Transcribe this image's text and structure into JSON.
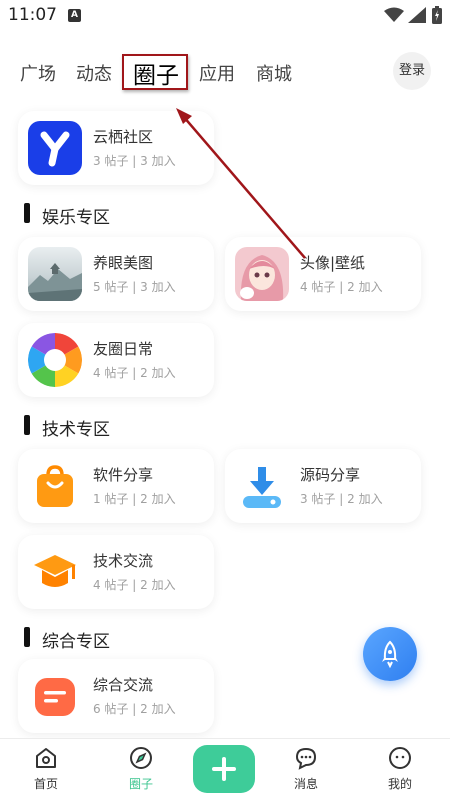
{
  "status_bar": {
    "time": "11:07",
    "notification_letter": "A"
  },
  "tabs": [
    {
      "label": "广场"
    },
    {
      "label": "动态"
    },
    {
      "label": "圈子"
    },
    {
      "label": "应用"
    },
    {
      "label": "商城"
    }
  ],
  "login_label": "登录",
  "featured": {
    "name": "云栖社区",
    "meta": "3 帖子 | 3 加入"
  },
  "sections": [
    {
      "title": "娱乐专区",
      "items": [
        {
          "name": "养眼美图",
          "meta": "5 帖子 | 3 加入"
        },
        {
          "name": "头像|壁纸",
          "meta": "4 帖子 | 2 加入"
        },
        {
          "name": "友圈日常",
          "meta": "4 帖子 | 2 加入"
        }
      ]
    },
    {
      "title": "技术专区",
      "items": [
        {
          "name": "软件分享",
          "meta": "1 帖子 | 2 加入"
        },
        {
          "name": "源码分享",
          "meta": "3 帖子 | 2 加入"
        },
        {
          "name": "技术交流",
          "meta": "4 帖子 | 2 加入"
        }
      ]
    },
    {
      "title": "综合专区",
      "items": [
        {
          "name": "综合交流",
          "meta": "6 帖子 | 2 加入"
        }
      ]
    }
  ],
  "bottom_nav": [
    {
      "label": "首页",
      "icon": "home-icon"
    },
    {
      "label": "圈子",
      "icon": "compass-icon"
    },
    {
      "label": "",
      "icon": "plus-icon"
    },
    {
      "label": "消息",
      "icon": "chat-icon"
    },
    {
      "label": "我的",
      "icon": "profile-icon"
    }
  ],
  "colors": {
    "accent": "#3ecc99",
    "fab": "#2f7ff0",
    "highlight_border": "#a0161a"
  }
}
